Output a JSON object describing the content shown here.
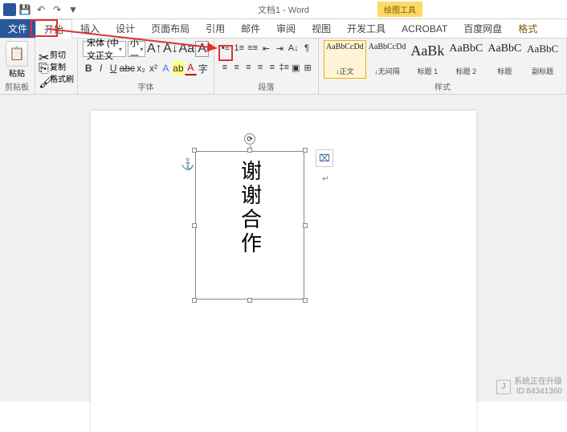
{
  "titlebar": {
    "title": "文档1 - Word",
    "context_label": "绘图工具"
  },
  "tabs": {
    "file": "文件",
    "items": [
      "开始",
      "插入",
      "设计",
      "页面布局",
      "引用",
      "邮件",
      "审阅",
      "视图",
      "开发工具",
      "ACROBAT",
      "百度网盘"
    ],
    "context": "格式",
    "active": "开始"
  },
  "clipboard": {
    "paste": "粘贴",
    "cut": "剪切",
    "copy": "复制",
    "painter": "格式刷",
    "label": "剪贴板"
  },
  "font": {
    "name": "宋体 (中文正文",
    "size": "小一",
    "label": "字体"
  },
  "paragraph": {
    "label": "段落"
  },
  "styles": {
    "label": "样式",
    "items": [
      {
        "preview": "AaBbCcDd",
        "name": "↓正文",
        "size": "10px",
        "selected": true
      },
      {
        "preview": "AaBbCcDd",
        "name": "↓无间隔",
        "size": "10px"
      },
      {
        "preview": "AaBk",
        "name": "标题 1",
        "size": "18px"
      },
      {
        "preview": "AaBbC",
        "name": "标题 2",
        "size": "14px"
      },
      {
        "preview": "AaBbC",
        "name": "标题",
        "size": "14px"
      },
      {
        "preview": "AaBbC",
        "name": "副标题",
        "size": "13px"
      }
    ]
  },
  "document": {
    "textbox_content": "谢谢合作"
  },
  "watermark": {
    "line1": "系统正在升级",
    "line2": "ID:84341360"
  }
}
